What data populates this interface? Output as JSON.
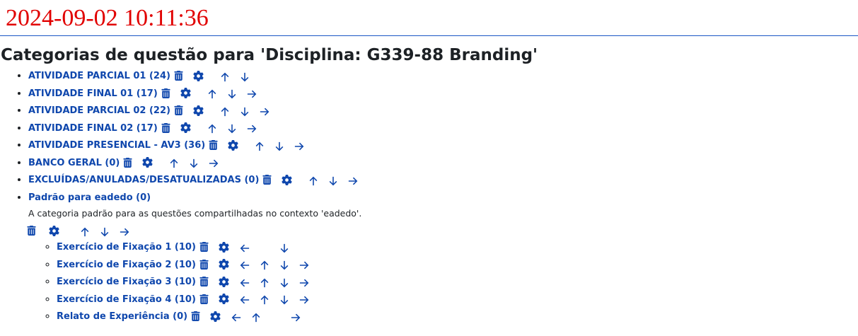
{
  "timestamp": "2024-09-02 10:11:36",
  "page_title": "Categorias de questão para 'Disciplina: G339-88 Branding'",
  "categories": [
    {
      "label": "ATIVIDADE PARCIAL 01 (24)",
      "arrows": [
        "up",
        "down"
      ]
    },
    {
      "label": "ATIVIDADE FINAL 01 (17)",
      "arrows": [
        "up",
        "down",
        "right"
      ]
    },
    {
      "label": "ATIVIDADE PARCIAL 02 (22)",
      "arrows": [
        "up",
        "down",
        "right"
      ]
    },
    {
      "label": "ATIVIDADE FINAL 02 (17)",
      "arrows": [
        "up",
        "down",
        "right"
      ]
    },
    {
      "label": "ATIVIDADE PRESENCIAL - AV3 (36)",
      "arrows": [
        "up",
        "down",
        "right"
      ]
    },
    {
      "label": "BANCO GERAL (0)",
      "arrows": [
        "up",
        "down",
        "right"
      ]
    },
    {
      "label": "EXCLUÍDAS/ANULADAS/DESATUALIZADAS (0)",
      "arrows": [
        "up",
        "down",
        "right"
      ]
    }
  ],
  "default_category": {
    "label": "Padrão para eadedo (0)",
    "description": "A categoria padrão para as questões compartilhadas no contexto 'eadedo'.",
    "arrows": [
      "up",
      "down",
      "right"
    ],
    "children": [
      {
        "label": "Exercício de Fixação 1 (10)",
        "arrows": [
          "left",
          "",
          "down",
          ""
        ]
      },
      {
        "label": "Exercício de Fixação 2 (10)",
        "arrows": [
          "left",
          "up",
          "down",
          "right"
        ]
      },
      {
        "label": "Exercício de Fixação 3 (10)",
        "arrows": [
          "left",
          "up",
          "down",
          "right"
        ]
      },
      {
        "label": "Exercício de Fixação 4 (10)",
        "arrows": [
          "left",
          "up",
          "down",
          "right"
        ]
      },
      {
        "label": "Relato de Experiência (0)",
        "arrows": [
          "left",
          "up",
          "",
          "right"
        ]
      }
    ]
  },
  "icons": {
    "delete": "trash-icon",
    "edit": "gear-icon",
    "move_up": "arrow-up-icon",
    "move_down": "arrow-down-icon",
    "indent": "arrow-right-icon",
    "outdent": "arrow-left-icon"
  },
  "colors": {
    "timestamp": "#e10000",
    "link": "#0f47ad",
    "rule": "#1a56c4"
  }
}
